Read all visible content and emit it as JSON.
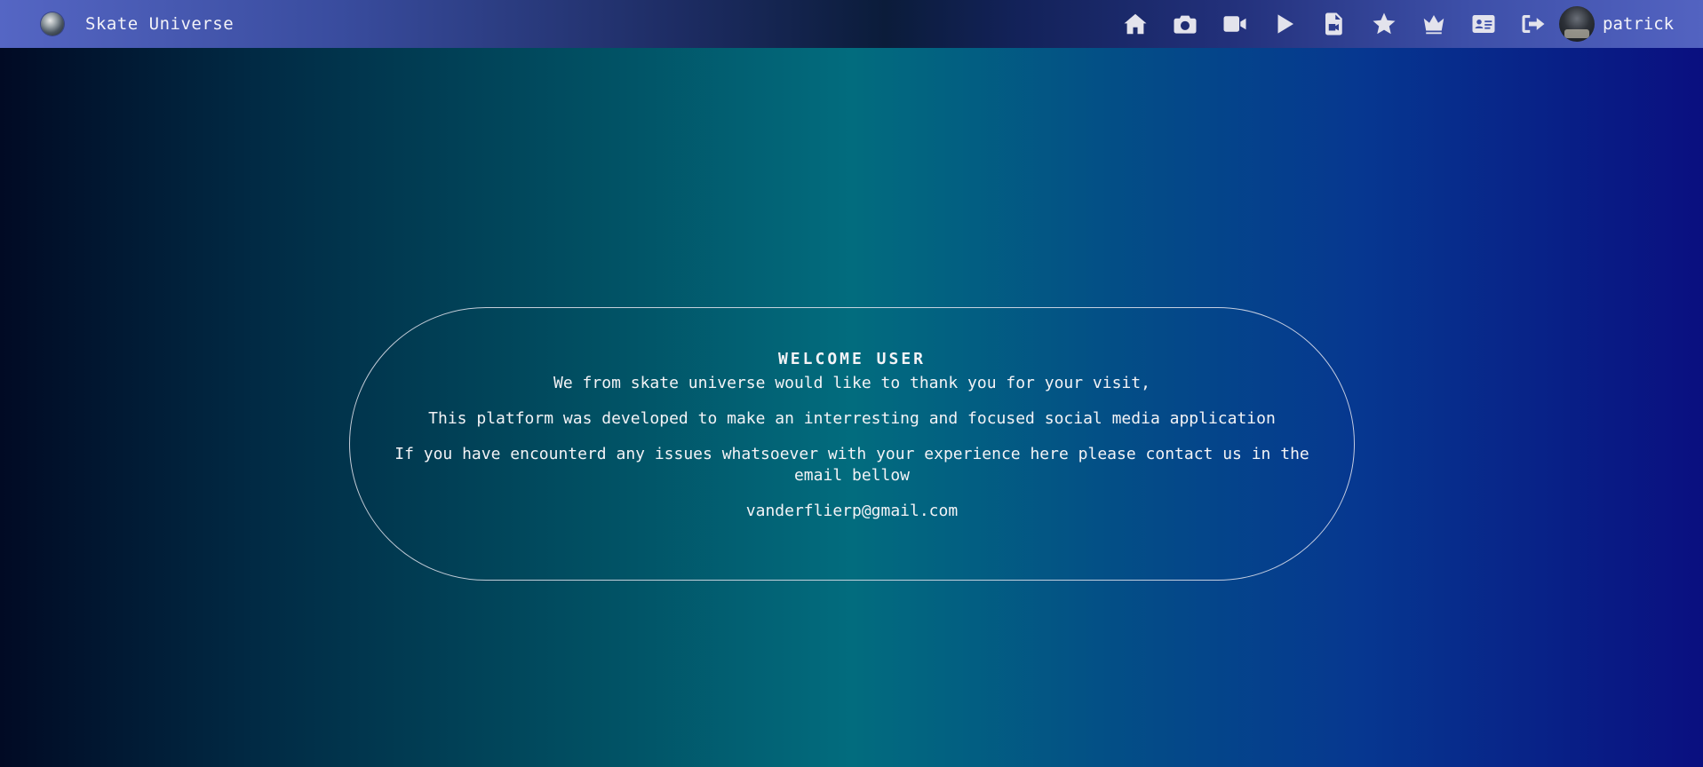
{
  "header": {
    "brand_title": "Skate Universe",
    "logo_icon": "globe-logo-icon",
    "nav_icons": [
      {
        "name": "home-icon",
        "label": "Home"
      },
      {
        "name": "camera-icon",
        "label": "Photos"
      },
      {
        "name": "video-icon",
        "label": "Videos"
      },
      {
        "name": "play-icon",
        "label": "Play"
      },
      {
        "name": "file-video-icon",
        "label": "Video file"
      },
      {
        "name": "star-icon",
        "label": "Favorites"
      },
      {
        "name": "crown-icon",
        "label": "Top"
      },
      {
        "name": "id-card-icon",
        "label": "Profile card"
      },
      {
        "name": "sign-out-icon",
        "label": "Sign out"
      }
    ],
    "user_name": "patrick"
  },
  "welcome": {
    "title": "WELCOME USER",
    "line1": "We from skate universe would like to thank you for your visit,",
    "line2": "This platform was developed to make an interresting and focused social media application",
    "line3": "If you have encounterd any issues whatsoever with your experience here please contact us in the email bellow",
    "email": "vanderflierp@gmail.com"
  },
  "colors": {
    "text": "#f3f3f6",
    "nav_icon": "#e3e3ec"
  }
}
